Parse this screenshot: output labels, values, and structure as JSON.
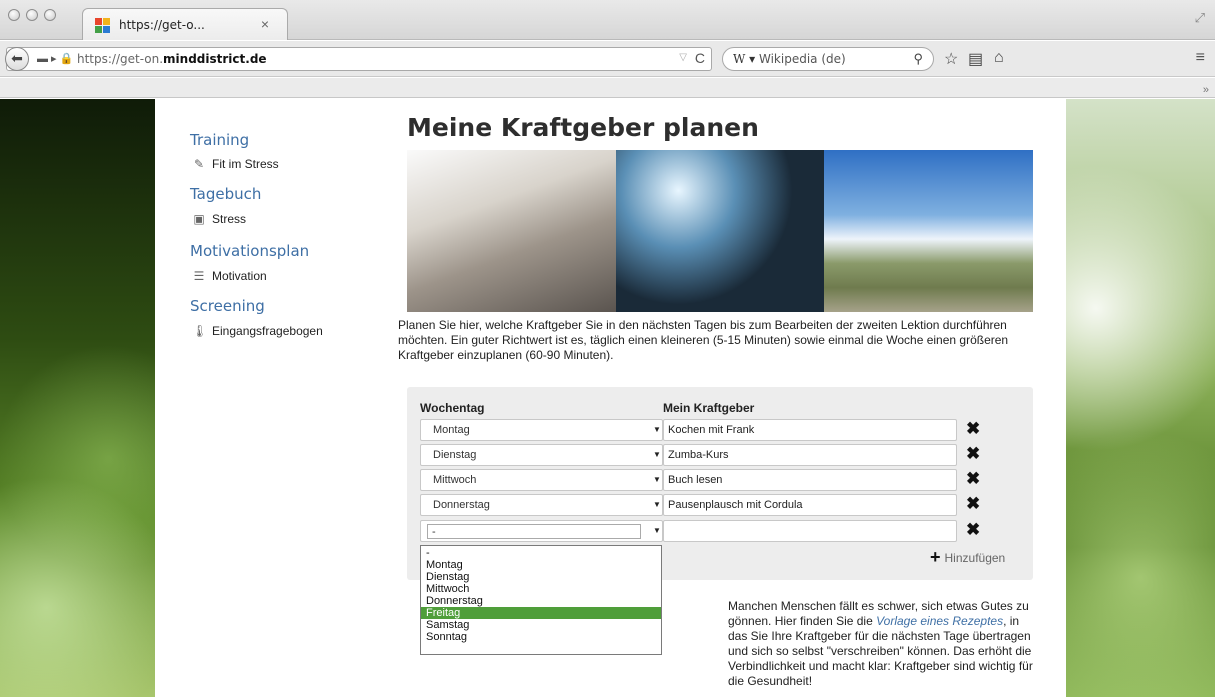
{
  "browser": {
    "tab_title": "https://get-o...",
    "tab_close": "×",
    "url_prefix": "https://get-on.",
    "url_domain": "minddistrict.de",
    "search_engine": "W ▾",
    "search_placeholder": "Wikipedia (de)",
    "icons": [
      "back-icon",
      "lock-icon",
      "reload-icon",
      "search-icon",
      "star-icon",
      "reader-icon",
      "home-icon",
      "menu-icon"
    ]
  },
  "sidebar": {
    "sections": [
      {
        "title": "Training",
        "item": "Fit im Stress",
        "icon": "pencil-icon"
      },
      {
        "title": "Tagebuch",
        "item": "Stress",
        "icon": "diary-icon"
      },
      {
        "title": "Motivationsplan",
        "item": "Motivation",
        "icon": "list-icon"
      },
      {
        "title": "Screening",
        "item": "Eingangsfragebogen",
        "icon": "thermometer-icon"
      }
    ]
  },
  "main": {
    "title": "Meine Kraftgeber planen",
    "intro": "Planen Sie hier, welche Kraftgeber Sie in den nächsten Tagen bis zum Bearbeiten der zweiten Lektion durchführen möchten. Ein guter Richtwert ist es, täglich einen kleineren (5-15 Minuten) sowie einmal die Woche einen größeren Kraftgeber einzuplanen (60-90 Minuten).",
    "col_weekday": "Wochentag",
    "col_activity": "Mein Kraftgeber",
    "rows": [
      {
        "day": "Montag",
        "activity": "Kochen mit Frank"
      },
      {
        "day": "Dienstag",
        "activity": "Zumba-Kurs"
      },
      {
        "day": "Mittwoch",
        "activity": "Buch lesen"
      },
      {
        "day": "Donnerstag",
        "activity": "Pausenplausch mit Cordula"
      },
      {
        "day": "-",
        "activity": ""
      }
    ],
    "add_label": "Hinzufügen",
    "dropdown_options": [
      "-",
      "Montag",
      "Dienstag",
      "Mittwoch",
      "Donnerstag",
      "Freitag",
      "Samstag",
      "Sonntag"
    ],
    "dropdown_highlighted": "Freitag",
    "note_before": "Manchen Menschen fällt es schwer, sich etwas Gutes zu gönnen. Hier finden Sie die ",
    "note_link": "Vorlage eines Rezeptes",
    "note_after": ", in das Sie Ihre Kraftgeber für die nächsten Tage übertragen und sich so selbst \"verschreiben\" können. Das erhöht die Verbindlichkeit und macht klar: Kraftgeber sind wichtig für die Gesundheit!"
  },
  "colors": {
    "link": "#3e6fa5",
    "highlight": "#4f9e3a"
  }
}
